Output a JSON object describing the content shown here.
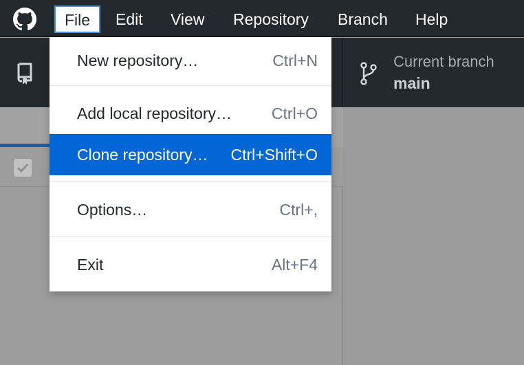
{
  "menubar": {
    "logo_icon": "github-octocat-icon",
    "items": [
      "File",
      "Edit",
      "View",
      "Repository",
      "Branch",
      "Help"
    ]
  },
  "toolbar": {
    "repo_icon": "repository-icon",
    "branch_icon": "git-branch-icon",
    "branch_caption": "Current branch",
    "branch_value": "main"
  },
  "file_menu": {
    "items": [
      {
        "label": "New repository…",
        "shortcut": "Ctrl+N"
      },
      {
        "label": "Add local repository…",
        "shortcut": "Ctrl+O"
      },
      {
        "label": "Clone repository…",
        "shortcut": "Ctrl+Shift+O",
        "highlighted": true
      },
      {
        "label": "Options…",
        "shortcut": "Ctrl+,"
      },
      {
        "label": "Exit",
        "shortcut": "Alt+F4"
      }
    ]
  },
  "colors": {
    "titlebar": "#24292e",
    "highlight": "#0366d6",
    "accent_underline": "#1e5ea8"
  }
}
